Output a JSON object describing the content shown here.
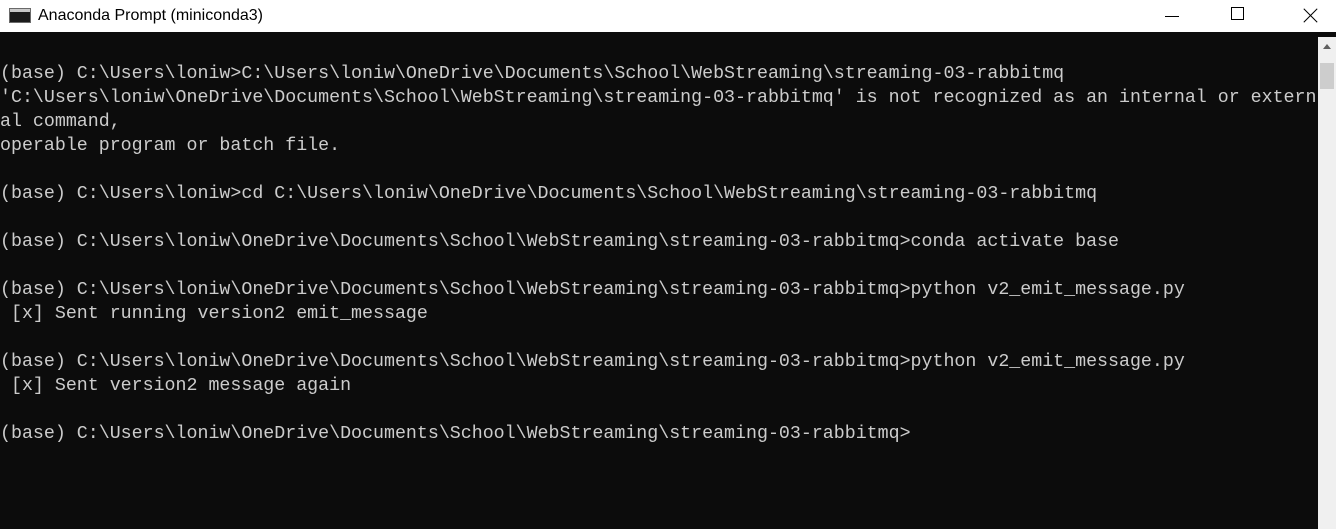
{
  "window": {
    "title": "Anaconda Prompt (miniconda3)",
    "icon": "console-window-icon",
    "controls": {
      "minimize": "minimize-icon",
      "maximize": "maximize-icon",
      "close": "close-icon"
    }
  },
  "console": {
    "lines": [
      "(base) C:\\Users\\loniw>C:\\Users\\loniw\\OneDrive\\Documents\\School\\WebStreaming\\streaming-03-rabbitmq",
      "'C:\\Users\\loniw\\OneDrive\\Documents\\School\\WebStreaming\\streaming-03-rabbitmq' is not recognized as an internal or extern",
      "al command,",
      "operable program or batch file.",
      "",
      "(base) C:\\Users\\loniw>cd C:\\Users\\loniw\\OneDrive\\Documents\\School\\WebStreaming\\streaming-03-rabbitmq",
      "",
      "(base) C:\\Users\\loniw\\OneDrive\\Documents\\School\\WebStreaming\\streaming-03-rabbitmq>conda activate base",
      "",
      "(base) C:\\Users\\loniw\\OneDrive\\Documents\\School\\WebStreaming\\streaming-03-rabbitmq>python v2_emit_message.py",
      " [x] Sent running version2 emit_message",
      "",
      "(base) C:\\Users\\loniw\\OneDrive\\Documents\\School\\WebStreaming\\streaming-03-rabbitmq>python v2_emit_message.py",
      " [x] Sent version2 message again",
      "",
      "(base) C:\\Users\\loniw\\OneDrive\\Documents\\School\\WebStreaming\\streaming-03-rabbitmq>"
    ]
  },
  "colors": {
    "console_background": "#0c0c0c",
    "console_text": "#cccccc",
    "titlebar_background": "#ffffff"
  }
}
